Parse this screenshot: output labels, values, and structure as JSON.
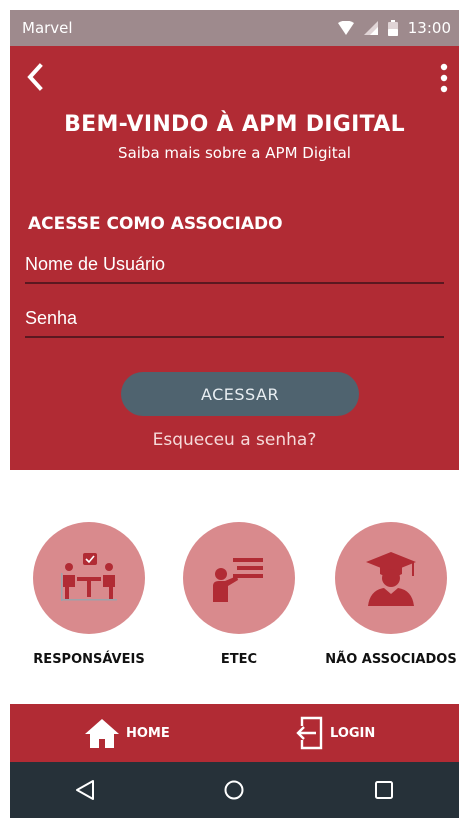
{
  "status_bar": {
    "carrier": "Marvel",
    "time": "13:00",
    "icons": [
      "wifi-icon",
      "signal-icon",
      "battery-icon"
    ]
  },
  "app_bar": {
    "back_icon": "back-arrow-icon",
    "menu_icon": "more-vert-icon"
  },
  "header": {
    "title": "BEM-VINDO À APM DIGITAL",
    "subtitle": "Saiba mais sobre a APM Digital"
  },
  "login": {
    "section_label": "ACESSE COMO ASSOCIADO",
    "username_placeholder": "Nome de Usuário",
    "password_placeholder": "Senha",
    "submit_label": "ACESSAR",
    "forgot_label": "Esqueceu a senha?"
  },
  "categories": [
    {
      "label": "RESPONSÁVEIS",
      "icon": "meeting-icon"
    },
    {
      "label": "ETEC",
      "icon": "teacher-board-icon"
    },
    {
      "label": "NÃO ASSOCIADOS",
      "icon": "graduate-icon"
    }
  ],
  "bottom_nav": {
    "home_label": "HOME",
    "login_label": "LOGIN"
  },
  "system_nav": [
    "back-triangle-icon",
    "home-circle-icon",
    "recents-square-icon"
  ],
  "colors": {
    "primary": "#b12b34",
    "circle": "#d98a8d",
    "button": "#4f636f",
    "status_bar": "#9e8a8d",
    "system_bar": "#263139"
  }
}
